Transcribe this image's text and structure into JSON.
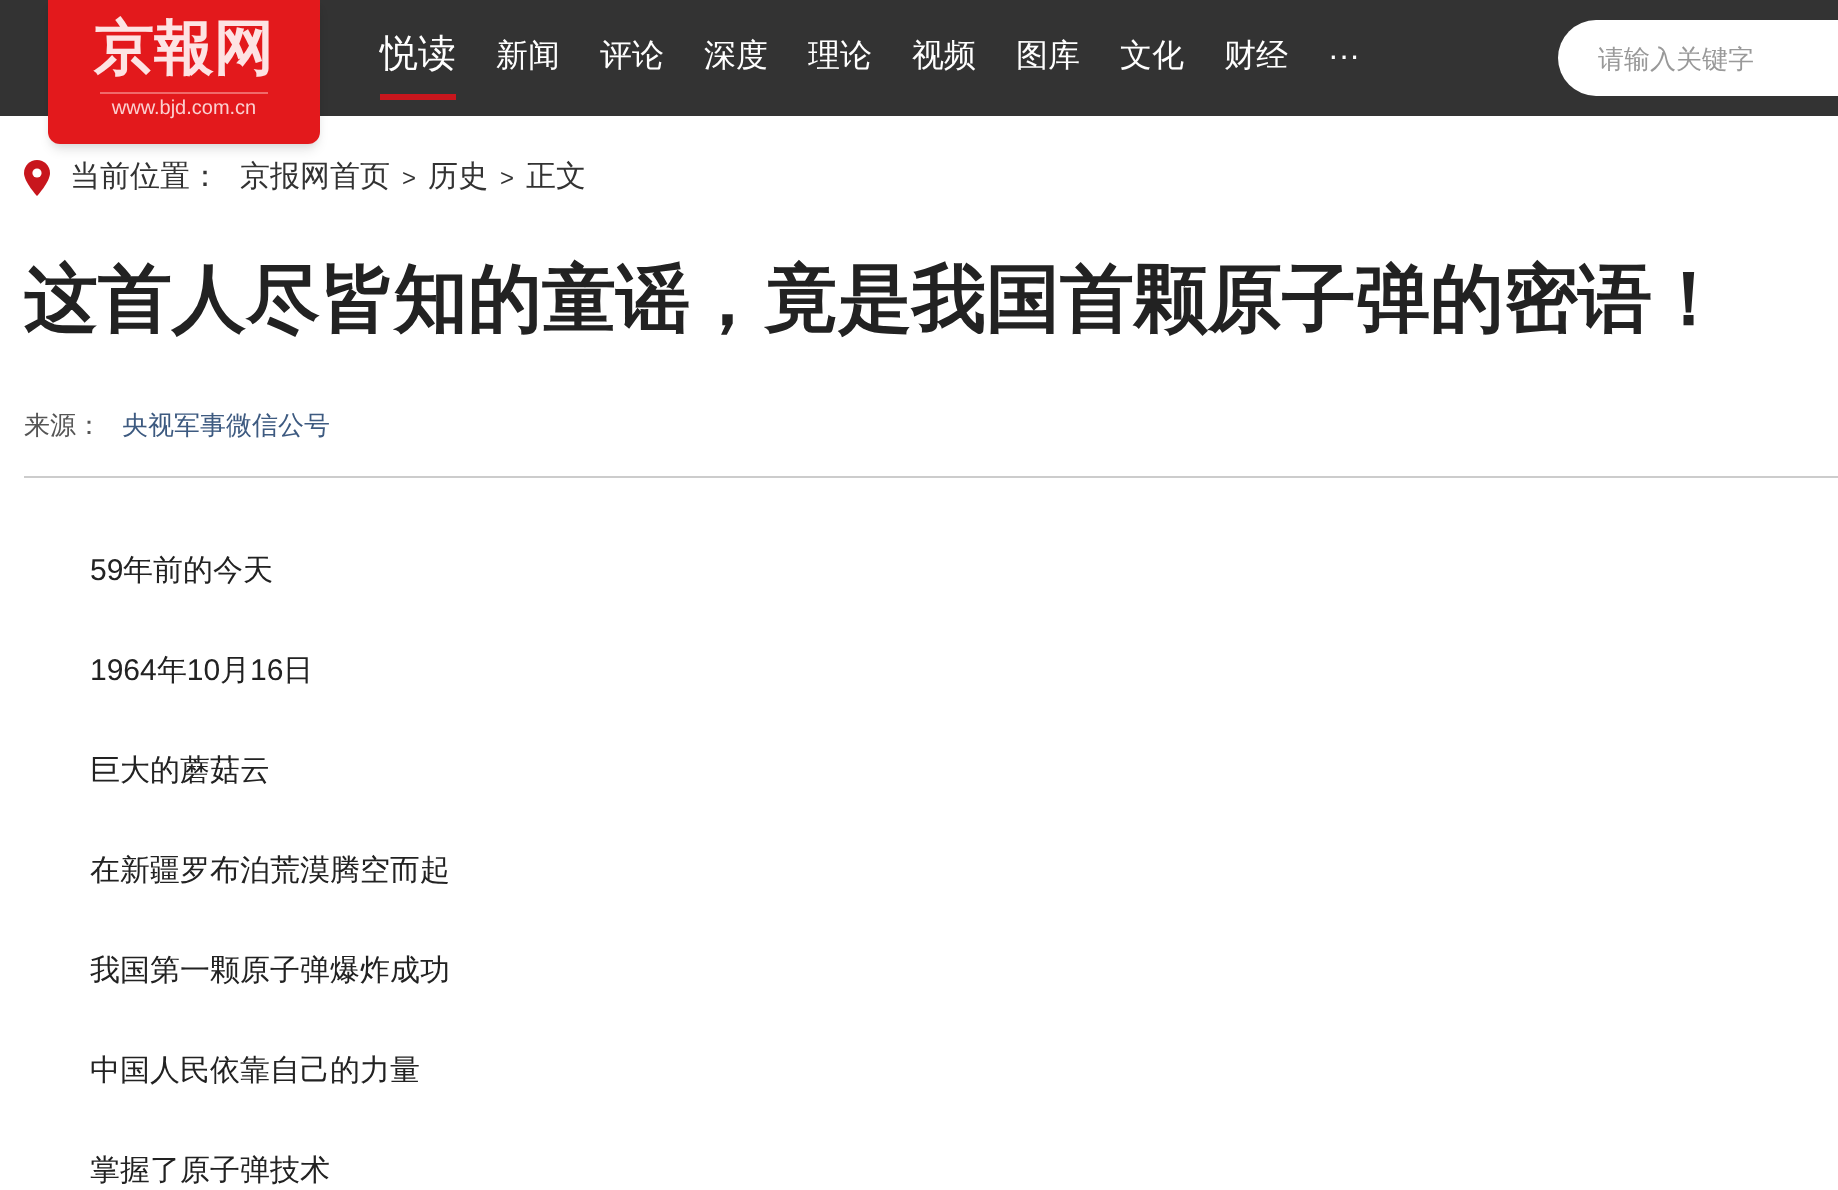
{
  "logo": {
    "name": "京報网",
    "url": "www.bjd.com.cn"
  },
  "nav": [
    {
      "label": "悦读",
      "selected": true
    },
    {
      "label": "新闻",
      "selected": false
    },
    {
      "label": "评论",
      "selected": false
    },
    {
      "label": "深度",
      "selected": false
    },
    {
      "label": "理论",
      "selected": false
    },
    {
      "label": "视频",
      "selected": false
    },
    {
      "label": "图库",
      "selected": false
    },
    {
      "label": "文化",
      "selected": false
    },
    {
      "label": "财经",
      "selected": false
    },
    {
      "label": "···",
      "selected": false
    }
  ],
  "search": {
    "placeholder": "请输入关键字"
  },
  "breadcrumb": {
    "label": "当前位置：",
    "items": [
      "京报网首页",
      "历史",
      "正文"
    ],
    "separator": ">"
  },
  "article": {
    "title": "这首人尽皆知的童谣，竟是我国首颗原子弹的密语！",
    "source_label": "来源：",
    "source": "央视军事微信公号",
    "paragraphs": [
      "59年前的今天",
      "1964年10月16日",
      "巨大的蘑菇云",
      "在新疆罗布泊荒漠腾空而起",
      "我国第一颗原子弹爆炸成功",
      "中国人民依靠自己的力量",
      "掌握了原子弹技术"
    ]
  }
}
